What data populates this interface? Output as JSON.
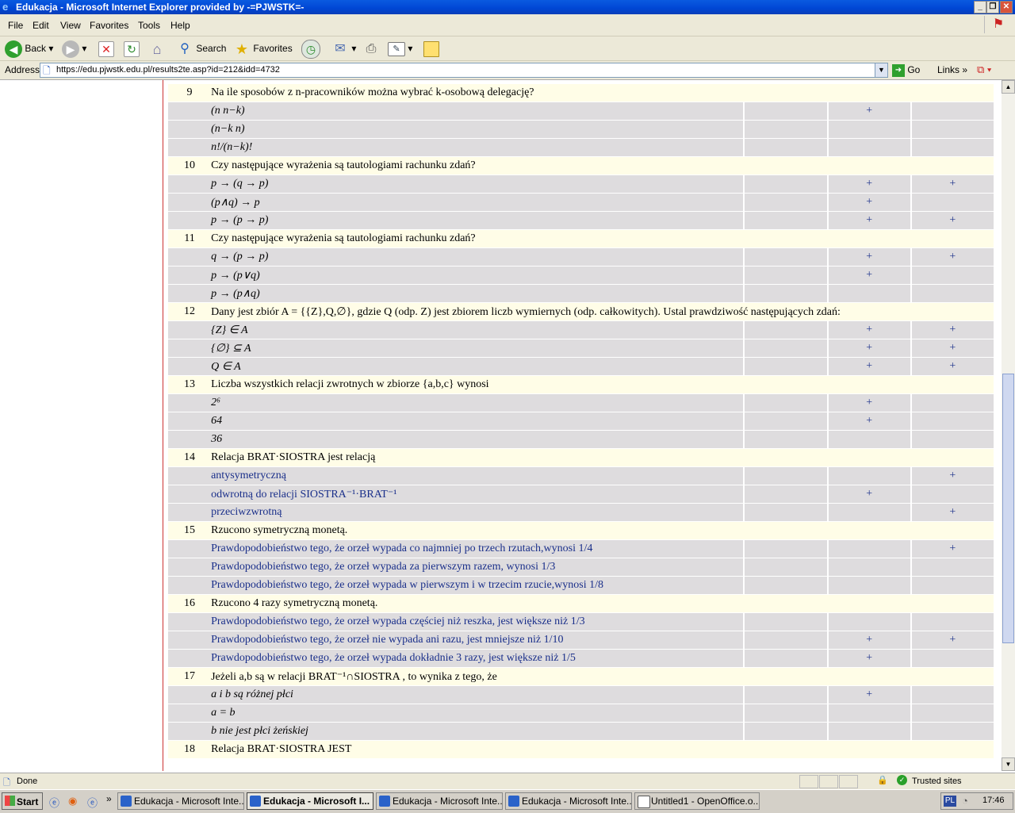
{
  "window": {
    "title": "Edukacja - Microsoft Internet Explorer provided by -=PJWSTK=-"
  },
  "menu": [
    "File",
    "Edit",
    "View",
    "Favorites",
    "Tools",
    "Help"
  ],
  "toolbar": {
    "back": "Back",
    "search": "Search",
    "favorites": "Favorites"
  },
  "address": {
    "label": "Address",
    "url": "https://edu.pjwstk.edu.pl/results2te.asp?id=212&idd=4732",
    "go": "Go",
    "links": "Links"
  },
  "questions": [
    {
      "num": "9",
      "text": "Na ile sposobów z n-pracowników można wybrać k-osobową delegację?",
      "answers": [
        {
          "text": "(n n−k)",
          "cols": [
            "",
            "+",
            ""
          ]
        },
        {
          "text": "(n−k n)",
          "cols": [
            "",
            "",
            ""
          ]
        },
        {
          "text": "n!/(n−k)!",
          "cols": [
            "",
            "",
            ""
          ]
        }
      ]
    },
    {
      "num": "10",
      "text": "Czy następujące wyrażenia są tautologiami rachunku zdań?",
      "answers": [
        {
          "text": "p → (q → p)",
          "cols": [
            "",
            "+",
            "+"
          ]
        },
        {
          "text": "(p∧q) → p",
          "cols": [
            "",
            "+",
            ""
          ]
        },
        {
          "text": "p → (p → p)",
          "cols": [
            "",
            "+",
            "+"
          ]
        }
      ]
    },
    {
      "num": "11",
      "text": "Czy następujące wyrażenia są tautologiami rachunku zdań?",
      "answers": [
        {
          "text": "q → (p → p)",
          "cols": [
            "",
            "+",
            "+"
          ]
        },
        {
          "text": "p → (p∨q)",
          "cols": [
            "",
            "+",
            ""
          ]
        },
        {
          "text": "p → (p∧q)",
          "cols": [
            "",
            "",
            ""
          ]
        }
      ]
    },
    {
      "num": "12",
      "text": "Dany jest zbiór A = {{Z},Q,∅}, gdzie Q (odp. Z) jest zbiorem liczb wymiernych (odp. całkowitych). Ustal prawdziwość następujących zdań:",
      "answers": [
        {
          "text": "{Z} ∈ A",
          "cols": [
            "",
            "+",
            "+"
          ]
        },
        {
          "text": "{∅} ⊆ A",
          "cols": [
            "",
            "+",
            "+"
          ]
        },
        {
          "text": "Q ∈ A",
          "cols": [
            "",
            "+",
            "+"
          ]
        }
      ]
    },
    {
      "num": "13",
      "text": "Liczba wszystkich relacji zwrotnych w zbiorze {a,b,c} wynosi",
      "answers": [
        {
          "text": "2⁶",
          "cols": [
            "",
            "+",
            ""
          ]
        },
        {
          "text": "64",
          "cols": [
            "",
            "+",
            ""
          ]
        },
        {
          "text": "36",
          "cols": [
            "",
            "",
            ""
          ]
        }
      ]
    },
    {
      "num": "14",
      "text": "Relacja BRAT·SIOSTRA jest relacją",
      "answers": [
        {
          "text": "antysymetryczną",
          "cols": [
            "",
            "",
            "+"
          ]
        },
        {
          "text": "odwrotną do relacji SIOSTRA⁻¹·BRAT⁻¹",
          "cols": [
            "",
            "+",
            ""
          ]
        },
        {
          "text": "przeciwzwrotną",
          "cols": [
            "",
            "",
            "+"
          ]
        }
      ]
    },
    {
      "num": "15",
      "text": "Rzucono symetryczną monetą.",
      "answers": [
        {
          "text": "Prawdopodobieństwo tego, że orzeł wypada co najmniej po trzech rzutach,wynosi 1/4",
          "cols": [
            "",
            "",
            "+"
          ]
        },
        {
          "text": "Prawdopodobieństwo tego, że orzeł wypada za pierwszym razem, wynosi 1/3",
          "cols": [
            "",
            "",
            ""
          ]
        },
        {
          "text": "Prawdopodobieństwo tego, że orzeł wypada w pierwszym i w trzecim rzucie,wynosi 1/8",
          "cols": [
            "",
            "",
            ""
          ]
        }
      ]
    },
    {
      "num": "16",
      "text": "Rzucono 4 razy symetryczną monetą.",
      "answers": [
        {
          "text": "Prawdopodobieństwo tego, że orzeł wypada częściej niż reszka, jest większe niż 1/3",
          "cols": [
            "",
            "",
            ""
          ]
        },
        {
          "text": "Prawdopodobieństwo tego, że orzeł nie wypada ani razu, jest mniejsze niż 1/10",
          "cols": [
            "",
            "+",
            "+"
          ]
        },
        {
          "text": "Prawdopodobieństwo tego, że orzeł wypada dokładnie 3 razy, jest większe niż 1/5",
          "cols": [
            "",
            "+",
            ""
          ]
        }
      ]
    },
    {
      "num": "17",
      "text": "Jeżeli a,b są w relacji BRAT⁻¹∩SIOSTRA , to wynika z tego, że",
      "answers": [
        {
          "text": "a i b są różnej płci",
          "cols": [
            "",
            "+",
            ""
          ]
        },
        {
          "text": "a = b",
          "cols": [
            "",
            "",
            ""
          ]
        },
        {
          "text": "b nie jest płci żeńskiej",
          "cols": [
            "",
            "",
            ""
          ]
        }
      ]
    },
    {
      "num": "18",
      "text": "Relacja BRAT·SIOSTRA JEST",
      "answers": []
    }
  ],
  "status": {
    "text": "Done",
    "zone": "Trusted sites"
  },
  "taskbar": {
    "start": "Start",
    "tasks": [
      "Edukacja - Microsoft Inte...",
      "Edukacja - Microsoft I...",
      "Edukacja - Microsoft Inte...",
      "Edukacja - Microsoft Inte...",
      "Untitled1 - OpenOffice.o..."
    ],
    "lang": "PL",
    "clock": "17:46"
  }
}
